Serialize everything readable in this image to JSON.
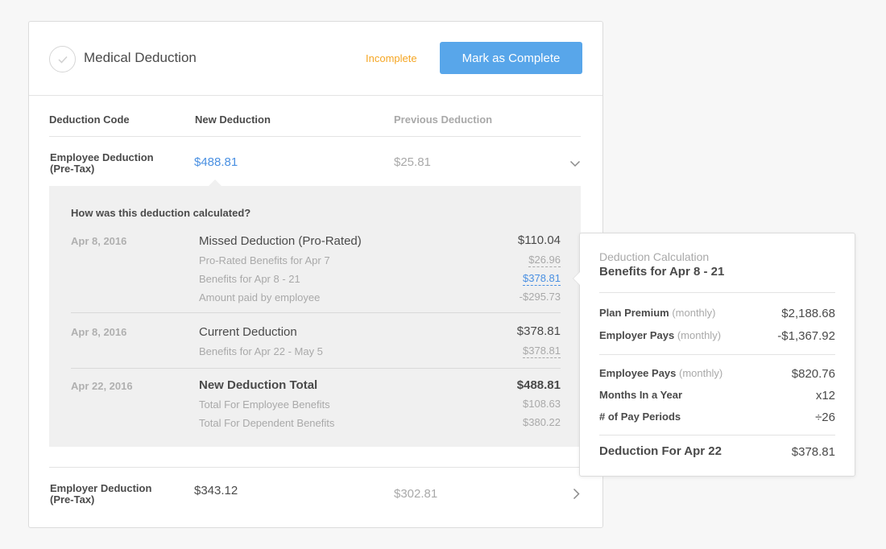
{
  "card": {
    "title": "Medical Deduction",
    "status": "Incomplete",
    "status_color": "#f5a623",
    "complete_button": "Mark as Complete",
    "accent_color": "#58a6ea",
    "check_icon": "check-icon"
  },
  "table": {
    "headers": {
      "code": "Deduction Code",
      "new": "New Deduction",
      "previous": "Previous Deduction"
    },
    "rows": [
      {
        "label_line1": "Employee Deduction",
        "label_line2": "(Pre-Tax)",
        "new_amount": "$488.81",
        "previous_amount": "$25.81",
        "icon": "chevron-down-icon"
      },
      {
        "label_line1": "Employer Deduction",
        "label_line2": "(Pre-Tax)",
        "new_amount": "$343.12",
        "previous_amount": "$302.81",
        "icon": "chevron-right-icon"
      }
    ]
  },
  "calc": {
    "question": "How was this deduction calculated?",
    "groups": [
      {
        "date": "Apr 8, 2016",
        "title": "Missed Deduction (Pro-Rated)",
        "value": "$110.04",
        "lines": [
          {
            "label": "Pro-Rated Benefits for Apr 7",
            "value": "$26.96"
          },
          {
            "label": "Benefits for Apr 8 - 21",
            "value": "$378.81"
          },
          {
            "label": "Amount paid by employee",
            "value": "-$295.73"
          }
        ]
      },
      {
        "date": "Apr 8, 2016",
        "title": "Current Deduction",
        "value": "$378.81",
        "lines": [
          {
            "label": "Benefits for Apr 22 - May 5",
            "value": "$378.81"
          }
        ]
      },
      {
        "date": "Apr 22, 2016",
        "title": "New Deduction Total",
        "value": "$488.81",
        "lines": [
          {
            "label": "Total For Employee Benefits",
            "value": "$108.63"
          },
          {
            "label": "Total For Dependent Benefits",
            "value": "$380.22"
          }
        ]
      }
    ]
  },
  "popover": {
    "kicker": "Deduction Calculation",
    "title": "Benefits for Apr 8 - 21",
    "items": [
      {
        "label": "Plan Premium",
        "note": "(monthly)",
        "value": "$2,188.68"
      },
      {
        "label": "Employer Pays",
        "note": "(monthly)",
        "value": "-$1,367.92"
      },
      {
        "label": "Employee Pays",
        "note": "(monthly)",
        "value": "$820.76"
      },
      {
        "label": "Months In a Year",
        "note": "",
        "value": "x12"
      },
      {
        "label": "# of Pay Periods",
        "note": "",
        "value": "÷26"
      }
    ],
    "total_label": "Deduction For Apr 22",
    "total_value": "$378.81"
  }
}
